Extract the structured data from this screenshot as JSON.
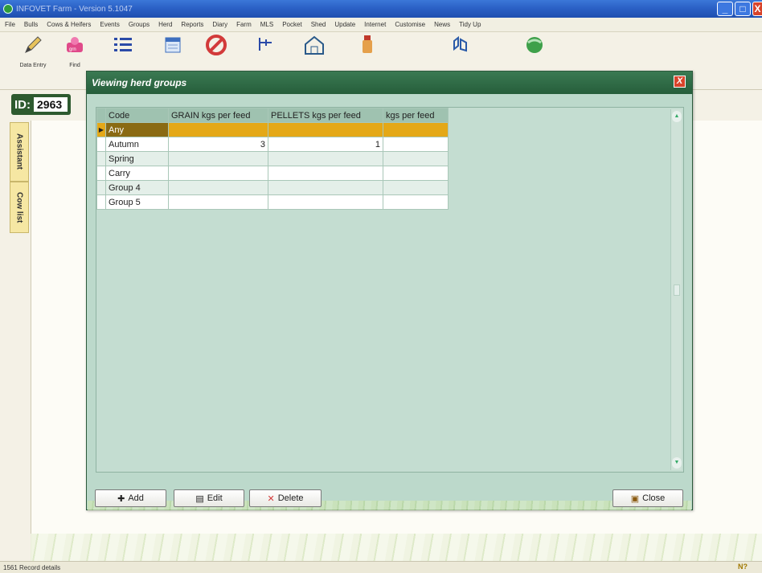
{
  "window": {
    "title": "INFOVET Farm - Version 5.1047",
    "min_label": "_",
    "max_label": "□",
    "close_label": "X"
  },
  "menu": [
    "File",
    "Bulls",
    "Cows & Heifers",
    "Events",
    "Groups",
    "Herd",
    "Reports",
    "Diary",
    "Farm",
    "MLS",
    "Pocket",
    "Shed",
    "Update",
    "Internet",
    "Customise",
    "News",
    "Tidy Up"
  ],
  "toolbar": {
    "tools": [
      {
        "label": "Data Entry",
        "icon": "pencil-icon"
      },
      {
        "label": "Find",
        "icon": "cow-icon"
      },
      {
        "label": "",
        "icon": "list-icon"
      },
      {
        "label": "",
        "icon": "calendar-icon"
      },
      {
        "label": "",
        "icon": "no-entry-icon"
      },
      {
        "label": "",
        "icon": "tree-icon"
      },
      {
        "label": "",
        "icon": "barn-icon"
      },
      {
        "label": "",
        "icon": "bottle-icon"
      },
      {
        "label": "",
        "icon": "tag-icon"
      },
      {
        "label": "",
        "icon": "globe-icon"
      }
    ]
  },
  "id_bar": {
    "label": "ID:",
    "value": "2963"
  },
  "side_tabs": {
    "assistant": "Assistant",
    "cow_list": "Cow list"
  },
  "dialog": {
    "title": "Viewing herd groups",
    "close_label": "X",
    "columns": [
      "Code",
      "GRAIN kgs per feed",
      "PELLETS kgs per feed",
      "kgs per feed"
    ],
    "rows": [
      {
        "code": "Any",
        "grain": "",
        "pellets": "",
        "kgs": "",
        "selected": true
      },
      {
        "code": "Autumn",
        "grain": "3",
        "pellets": "1",
        "kgs": ""
      },
      {
        "code": "Spring",
        "grain": "",
        "pellets": "",
        "kgs": ""
      },
      {
        "code": "Carry",
        "grain": "",
        "pellets": "",
        "kgs": ""
      },
      {
        "code": "Group 4",
        "grain": "",
        "pellets": "",
        "kgs": ""
      },
      {
        "code": "Group 5",
        "grain": "",
        "pellets": "",
        "kgs": ""
      }
    ],
    "buttons": {
      "add": "Add",
      "edit": "Edit",
      "delete": "Delete",
      "close": "Close"
    }
  },
  "status": {
    "text": "1561 Record details",
    "help": "N?"
  }
}
